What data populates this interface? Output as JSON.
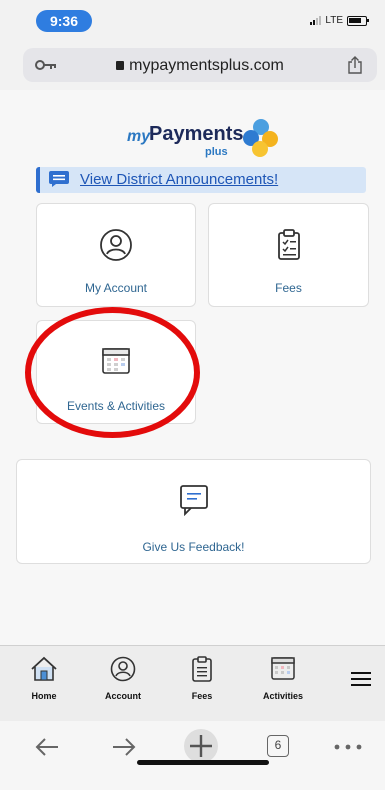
{
  "status_bar": {
    "time": "9:36",
    "network": "LTE"
  },
  "browser": {
    "url": "mypaymentsplus.com",
    "tab_count": "6"
  },
  "logo": {
    "my": "my",
    "payments": "Payments",
    "plus": "plus"
  },
  "announcement": {
    "label": "View District Announcements!"
  },
  "tiles": {
    "my_account": "My Account",
    "fees": "Fees",
    "events": "Events & Activities",
    "feedback": "Give Us Feedback!"
  },
  "tabbar": {
    "items": [
      {
        "label": "Home"
      },
      {
        "label": "Account"
      },
      {
        "label": "Fees"
      },
      {
        "label": "Activities"
      }
    ]
  },
  "colors": {
    "accent": "#2f6fcf",
    "annotation": "#e30b0b",
    "time_pill": "#2f7de0"
  }
}
